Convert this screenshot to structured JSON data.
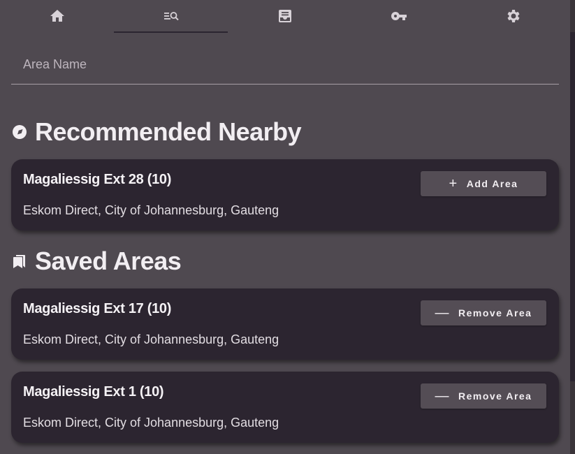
{
  "nav": {
    "tabs": [
      {
        "icon": "home-icon"
      },
      {
        "icon": "search-list-icon",
        "active": true
      },
      {
        "icon": "inbox-icon"
      },
      {
        "icon": "key-icon"
      },
      {
        "icon": "gear-icon"
      }
    ]
  },
  "search": {
    "placeholder": "Area Name",
    "value": ""
  },
  "recommended": {
    "title": "Recommended Nearby",
    "icon": "compass-icon",
    "items": [
      {
        "name": "Magaliessig Ext 28 (10)",
        "description": "Eskom Direct, City of Johannesburg, Gauteng",
        "button_glyph": "+",
        "button_label": "Add Area"
      }
    ]
  },
  "saved": {
    "title": "Saved Areas",
    "icon": "bookmarks-icon",
    "items": [
      {
        "name": "Magaliessig Ext 17 (10)",
        "description": "Eskom Direct, City of Johannesburg, Gauteng",
        "button_glyph": "—",
        "button_label": "Remove Area"
      },
      {
        "name": "Magaliessig Ext 1 (10)",
        "description": "Eskom Direct, City of Johannesburg, Gauteng",
        "button_glyph": "—",
        "button_label": "Remove Area"
      }
    ]
  },
  "colors": {
    "background": "#4f4950",
    "card": "#2c2530",
    "button": "#544d55",
    "text": "#f2eef2"
  }
}
